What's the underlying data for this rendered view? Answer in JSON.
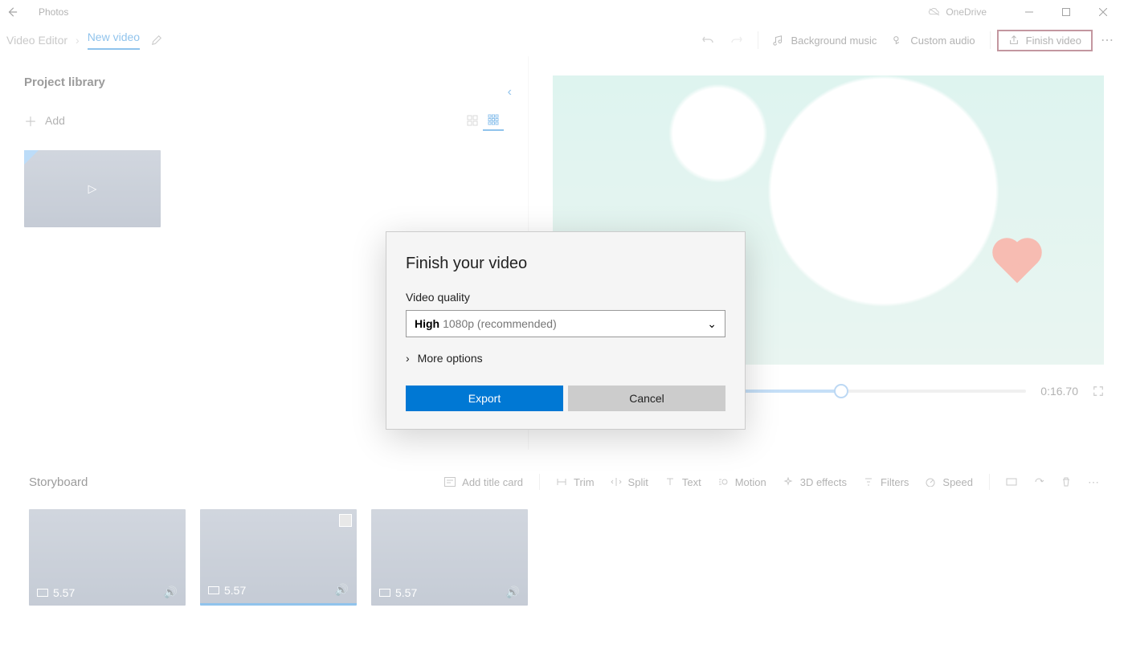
{
  "titlebar": {
    "app_name": "Photos",
    "onedrive": "OneDrive"
  },
  "breadcrumb": {
    "root": "Video Editor",
    "project": "New video"
  },
  "toolbar": {
    "background_music": "Background music",
    "custom_audio": "Custom audio",
    "finish_video": "Finish video"
  },
  "library": {
    "title": "Project library",
    "add": "Add"
  },
  "timeline": {
    "time": "0:16.70"
  },
  "storyboard": {
    "title": "Storyboard",
    "tools": {
      "add_title_card": "Add title card",
      "trim": "Trim",
      "split": "Split",
      "text": "Text",
      "motion": "Motion",
      "effects": "3D effects",
      "filters": "Filters",
      "speed": "Speed"
    },
    "clips": [
      {
        "duration": "5.57"
      },
      {
        "duration": "5.57"
      },
      {
        "duration": "5.57"
      }
    ]
  },
  "dialog": {
    "title": "Finish your video",
    "quality_label": "Video quality",
    "quality_strong": "High",
    "quality_rest": "1080p (recommended)",
    "more": "More options",
    "export": "Export",
    "cancel": "Cancel"
  }
}
